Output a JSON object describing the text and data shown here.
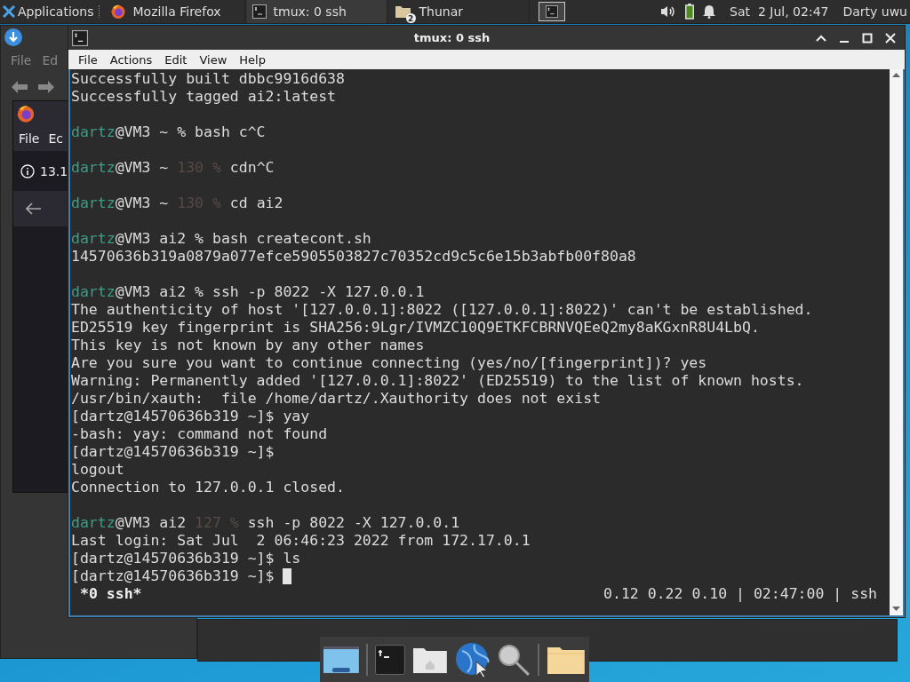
{
  "top_panel": {
    "applications_label": "Applications",
    "tasks": [
      {
        "kind": "firefox",
        "label": "Mozilla Firefox",
        "selected": false
      },
      {
        "kind": "terminal",
        "label": "tmux: 0 ssh",
        "selected": true
      },
      {
        "kind": "folder",
        "label": "Thunar",
        "badge": "2",
        "selected": false
      }
    ],
    "clock": "Sat  2 Jul, 02:47",
    "user": "Darty uwu"
  },
  "background_windows": {
    "file_manager_menu": [
      "File",
      "Ed"
    ],
    "browser_menu": [
      "File",
      "Ec"
    ],
    "browser_address": "13.1"
  },
  "terminal": {
    "title": "tmux: 0 ssh",
    "menu": [
      "File",
      "Actions",
      "Edit",
      "View",
      "Help"
    ],
    "lines": [
      {
        "kind": "output",
        "segments": [
          {
            "kind": "plain",
            "text": "Successfully built dbbc9916d638"
          }
        ]
      },
      {
        "kind": "output",
        "segments": [
          {
            "kind": "plain",
            "text": "Successfully tagged ai2:latest"
          }
        ]
      },
      {
        "kind": "blank"
      },
      {
        "kind": "output",
        "segments": [
          {
            "kind": "user",
            "text": "dartz"
          },
          {
            "kind": "plain",
            "text": "@VM3 ~ % bash c^C"
          }
        ]
      },
      {
        "kind": "blank"
      },
      {
        "kind": "output",
        "segments": [
          {
            "kind": "user",
            "text": "dartz"
          },
          {
            "kind": "plain",
            "text": "@VM3 ~ "
          },
          {
            "kind": "dim",
            "text": "130 %"
          },
          {
            "kind": "plain",
            "text": " cdn^C"
          }
        ]
      },
      {
        "kind": "blank"
      },
      {
        "kind": "output",
        "segments": [
          {
            "kind": "user",
            "text": "dartz"
          },
          {
            "kind": "plain",
            "text": "@VM3 ~ "
          },
          {
            "kind": "dim",
            "text": "130 %"
          },
          {
            "kind": "plain",
            "text": " cd ai2"
          }
        ]
      },
      {
        "kind": "blank"
      },
      {
        "kind": "output",
        "segments": [
          {
            "kind": "user",
            "text": "dartz"
          },
          {
            "kind": "plain",
            "text": "@VM3 ai2 % bash createcont.sh"
          }
        ]
      },
      {
        "kind": "output",
        "segments": [
          {
            "kind": "plain",
            "text": "14570636b319a0879a077efce5905503827c70352cd9c5c6e15b3abfb00f80a8"
          }
        ]
      },
      {
        "kind": "blank"
      },
      {
        "kind": "output",
        "segments": [
          {
            "kind": "user",
            "text": "dartz"
          },
          {
            "kind": "plain",
            "text": "@VM3 ai2 % ssh -p 8022 -X 127.0.0.1"
          }
        ]
      },
      {
        "kind": "output",
        "segments": [
          {
            "kind": "plain",
            "text": "The authenticity of host '[127.0.0.1]:8022 ([127.0.0.1]:8022)' can't be established."
          }
        ]
      },
      {
        "kind": "output",
        "segments": [
          {
            "kind": "plain",
            "text": "ED25519 key fingerprint is SHA256:9Lgr/IVMZC10Q9ETKFCBRNVQEeQ2my8aKGxnR8U4LbQ."
          }
        ]
      },
      {
        "kind": "output",
        "segments": [
          {
            "kind": "plain",
            "text": "This key is not known by any other names"
          }
        ]
      },
      {
        "kind": "output",
        "segments": [
          {
            "kind": "plain",
            "text": "Are you sure you want to continue connecting (yes/no/[fingerprint])? yes"
          }
        ]
      },
      {
        "kind": "output",
        "segments": [
          {
            "kind": "plain",
            "text": "Warning: Permanently added '[127.0.0.1]:8022' (ED25519) to the list of known hosts."
          }
        ]
      },
      {
        "kind": "output",
        "segments": [
          {
            "kind": "plain",
            "text": "/usr/bin/xauth:  file /home/dartz/.Xauthority does not exist"
          }
        ]
      },
      {
        "kind": "output",
        "segments": [
          {
            "kind": "plain",
            "text": "[dartz@14570636b319 ~]$ yay"
          }
        ]
      },
      {
        "kind": "output",
        "segments": [
          {
            "kind": "plain",
            "text": "-bash: yay: command not found"
          }
        ]
      },
      {
        "kind": "output",
        "segments": [
          {
            "kind": "plain",
            "text": "[dartz@14570636b319 ~]$"
          }
        ]
      },
      {
        "kind": "output",
        "segments": [
          {
            "kind": "plain",
            "text": "logout"
          }
        ]
      },
      {
        "kind": "output",
        "segments": [
          {
            "kind": "plain",
            "text": "Connection to 127.0.0.1 closed."
          }
        ]
      },
      {
        "kind": "blank"
      },
      {
        "kind": "output",
        "segments": [
          {
            "kind": "user",
            "text": "dartz"
          },
          {
            "kind": "plain",
            "text": "@VM3 ai2 "
          },
          {
            "kind": "dim",
            "text": "127 %"
          },
          {
            "kind": "plain",
            "text": " ssh -p 8022 -X 127.0.0.1"
          }
        ]
      },
      {
        "kind": "output",
        "segments": [
          {
            "kind": "plain",
            "text": "Last login: Sat Jul  2 06:46:23 2022 from 172.17.0.1"
          }
        ]
      },
      {
        "kind": "output",
        "segments": [
          {
            "kind": "plain",
            "text": "[dartz@14570636b319 ~]$ ls"
          }
        ]
      },
      {
        "kind": "output",
        "cursor": true,
        "segments": [
          {
            "kind": "plain",
            "text": "[dartz@14570636b319 ~]$"
          }
        ]
      }
    ],
    "status_left": "*0 ssh*",
    "status_right": "0.12 0.22 0.10 | 02:47:00 | ssh"
  },
  "dock": {
    "items": [
      {
        "kind": "desktop"
      },
      {
        "kind": "separator"
      },
      {
        "kind": "terminal"
      },
      {
        "kind": "home"
      },
      {
        "kind": "globe"
      },
      {
        "kind": "search"
      },
      {
        "kind": "separator"
      },
      {
        "kind": "folder"
      }
    ]
  }
}
